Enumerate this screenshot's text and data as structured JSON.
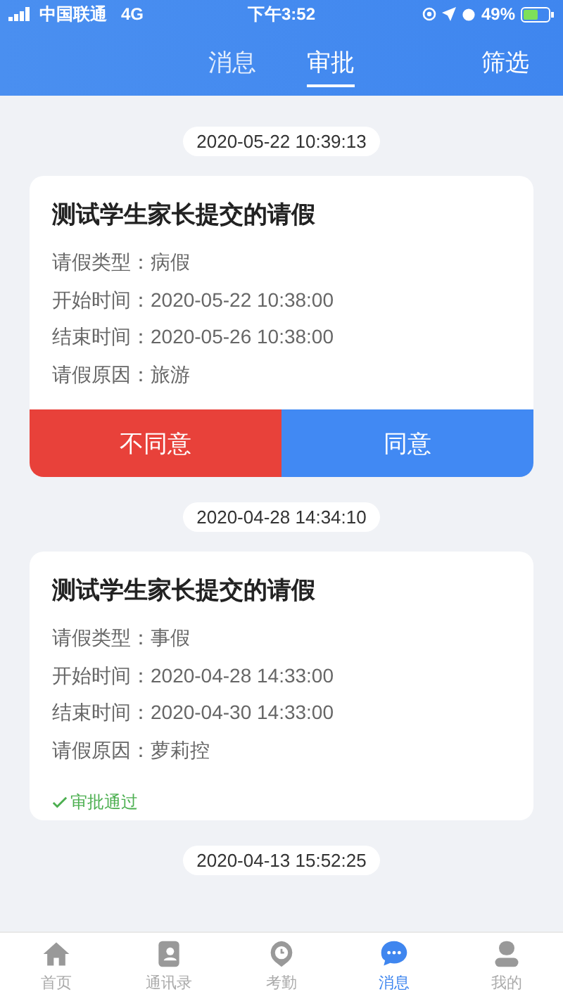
{
  "status_bar": {
    "carrier": "中国联通",
    "network": "4G",
    "time": "下午3:52",
    "battery": "49%"
  },
  "header": {
    "tabs": [
      {
        "label": "消息",
        "selected": false
      },
      {
        "label": "审批",
        "selected": true
      }
    ],
    "filter": "筛选"
  },
  "feed": [
    {
      "timestamp": "2020-05-22 10:39:13",
      "card": {
        "kind": "pending",
        "title": "测试学生家长提交的请假",
        "fields": [
          {
            "label": "请假类型：",
            "value": "病假"
          },
          {
            "label": "开始时间：",
            "value": "2020-05-22 10:38:00"
          },
          {
            "label": "结束时间：",
            "value": "2020-05-26 10:38:00"
          },
          {
            "label": "请假原因：",
            "value": "旅游"
          }
        ],
        "reject": "不同意",
        "approve": "同意"
      }
    },
    {
      "timestamp": "2020-04-28 14:34:10",
      "card": {
        "kind": "approved",
        "title": "测试学生家长提交的请假",
        "fields": [
          {
            "label": "请假类型：",
            "value": "事假"
          },
          {
            "label": "开始时间：",
            "value": "2020-04-28 14:33:00"
          },
          {
            "label": "结束时间：",
            "value": "2020-04-30 14:33:00"
          },
          {
            "label": "请假原因：",
            "value": "萝莉控"
          }
        ],
        "status": "审批通过"
      }
    },
    {
      "timestamp": "2020-04-13 15:52:25"
    }
  ],
  "tab_bar": [
    {
      "label": "首页",
      "selected": false
    },
    {
      "label": "通讯录",
      "selected": false
    },
    {
      "label": "考勤",
      "selected": false
    },
    {
      "label": "消息",
      "selected": true
    },
    {
      "label": "我的",
      "selected": false
    }
  ]
}
